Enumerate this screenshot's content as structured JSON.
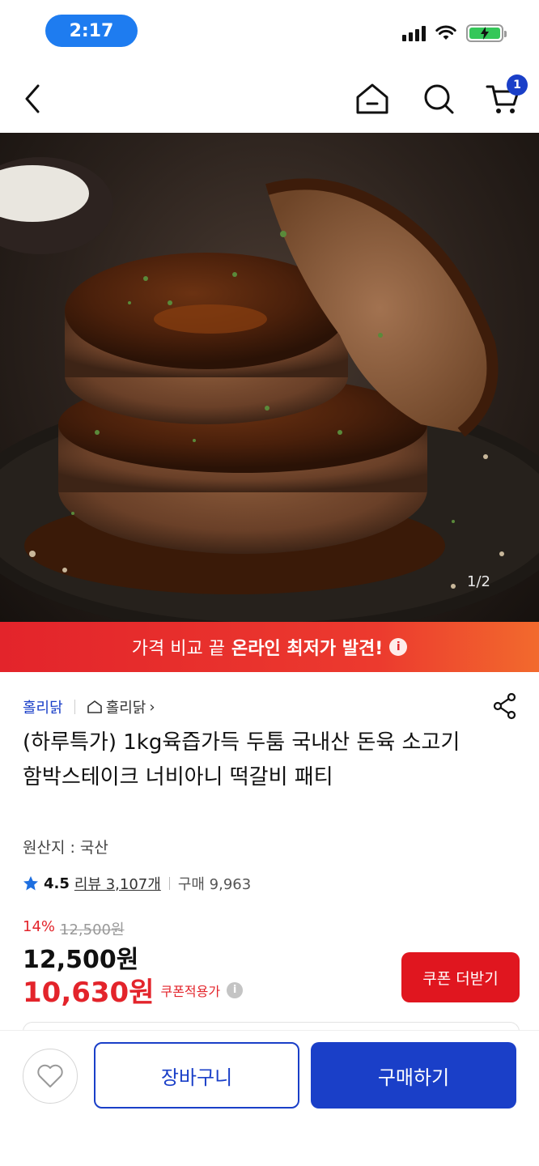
{
  "status_bar": {
    "time": "2:17"
  },
  "nav": {
    "cart_count": "1"
  },
  "hero": {
    "page_indicator": "1/2"
  },
  "promo": {
    "text_regular": "가격 비교 끝",
    "text_bold": "온라인 최저가 발견!",
    "info_glyph": "i"
  },
  "product": {
    "brand": "홀리닭",
    "store_link": "홀리닭",
    "store_chevron": "›",
    "title": "(하루특가) 1kg육즙가득 두툼 국내산 돈육 소고기 함박스테이크 너비아니 떡갈비 패티",
    "origin": "원산지 : 국산",
    "rating": "4.5",
    "reviews": "리뷰 3,107개",
    "purchases": "구매 9,963",
    "discount_pct": "14%",
    "original_price": "12,500원",
    "price": "12,500원",
    "coupon_price": "10,630원",
    "coupon_price_label": "쿠폰적용가",
    "coupon_info_glyph": "i",
    "coupon_button": "쿠폰 더받기"
  },
  "bottom_bar": {
    "cart_button": "장바구니",
    "buy_button": "구매하기"
  },
  "icons": {
    "back": "chevron-left-icon",
    "home": "home-icon",
    "search": "search-icon",
    "cart": "cart-icon",
    "share": "share-icon",
    "star": "star-icon",
    "heart": "heart-icon"
  },
  "colors": {
    "brand_blue": "#1a3fc8",
    "sale_red": "#e3242b",
    "star_blue": "#1e6fe0"
  }
}
